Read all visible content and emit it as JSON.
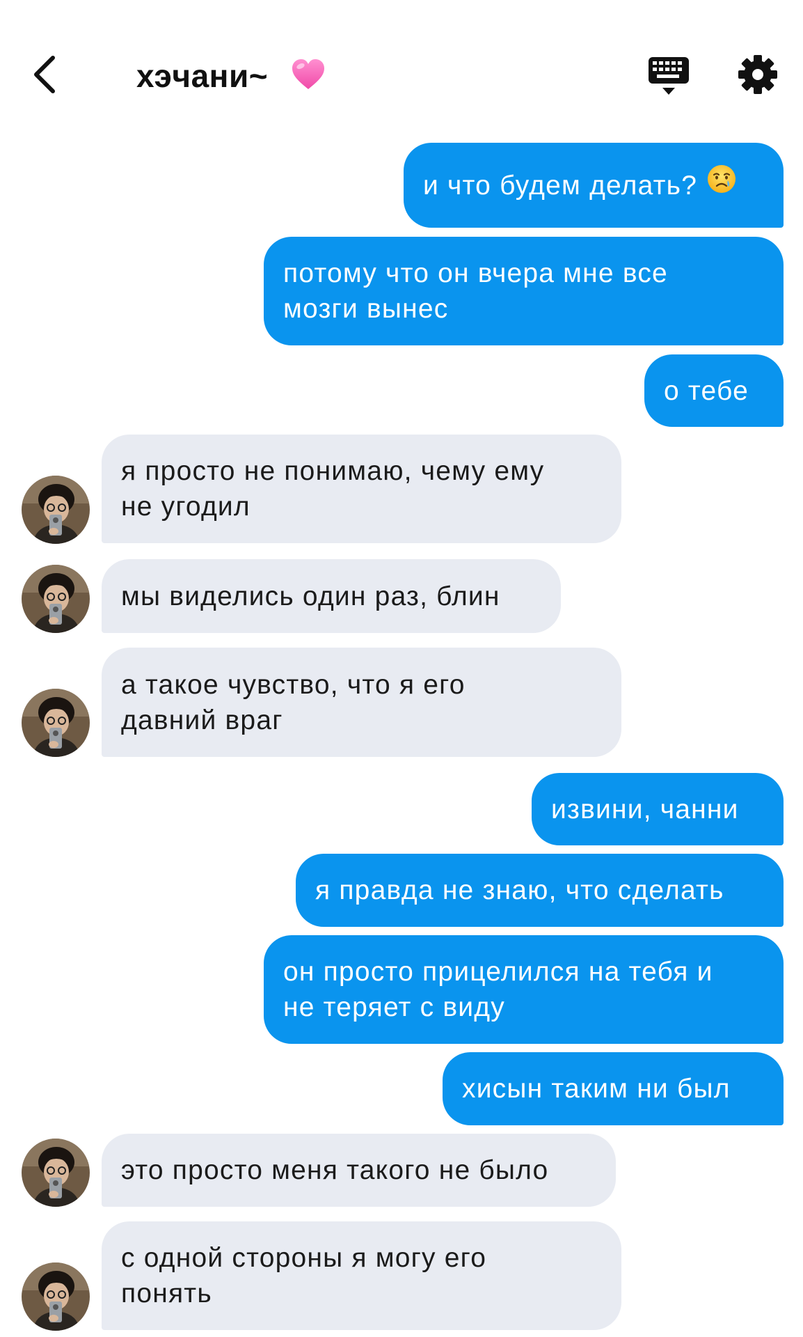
{
  "header": {
    "title": "хэчани~"
  },
  "messages": [
    {
      "dir": "out",
      "text": "и что будем делать?"
    },
    {
      "dir": "out",
      "text": "потому что он вчера мне все\nмозги вынес"
    },
    {
      "dir": "out",
      "text": "о тебе"
    },
    {
      "dir": "in",
      "text": "я просто не понимаю, чему ему\nне угодил"
    },
    {
      "dir": "in",
      "text": "мы виделись один раз, блин"
    },
    {
      "dir": "in",
      "text": "а такое чувство, что я его\nдавний враг"
    },
    {
      "dir": "out",
      "text": "извини, чанни"
    },
    {
      "dir": "out",
      "text": "я правда не знаю, что сделать"
    },
    {
      "dir": "out",
      "text": "он просто прицелился на тебя и\nне теряет с виду"
    },
    {
      "dir": "out",
      "text": "хисын таким ни был"
    },
    {
      "dir": "in",
      "text": "это просто меня такого не было"
    },
    {
      "dir": "in",
      "text": "с одной стороны я могу его\nпонять"
    }
  ],
  "colors": {
    "outgoing_bubble": "#0a94ee",
    "incoming_bubble": "#e8ebf2",
    "background": "#ffffff"
  },
  "icons": {
    "back": "chevron-left-icon",
    "heart": "pink-heart-emoji",
    "keyboard": "keyboard-icon",
    "settings": "gear-icon",
    "crying": "crying-face-emoji"
  }
}
